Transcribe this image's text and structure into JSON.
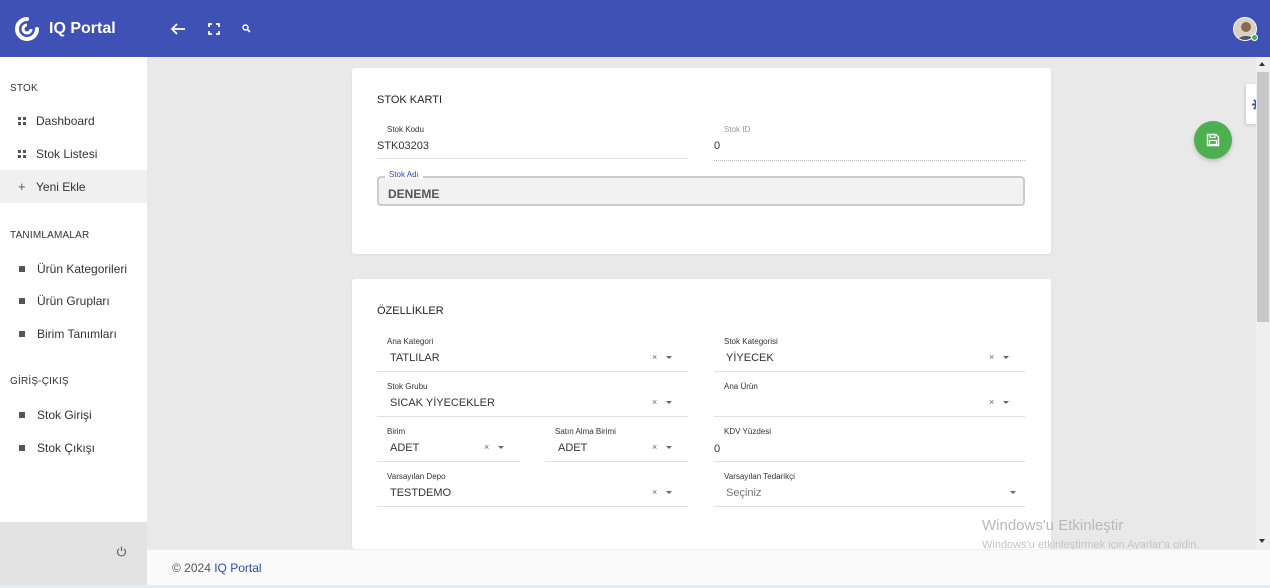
{
  "brand": {
    "name": "IQ Portal"
  },
  "sidebar": {
    "sections": [
      {
        "title": "STOK",
        "items": [
          {
            "label": "Dashboard",
            "icon": "grid-icon"
          },
          {
            "label": "Stok Listesi",
            "icon": "grid-icon"
          },
          {
            "label": "Yeni Ekle",
            "icon": "plus-icon",
            "active": true
          }
        ]
      },
      {
        "title": "TANIMLAMALAR",
        "items": [
          {
            "label": "Ürün Kategorileri",
            "icon": "square-icon"
          },
          {
            "label": "Ürün Grupları",
            "icon": "square-icon"
          },
          {
            "label": "Birim Tanımları",
            "icon": "square-icon"
          }
        ]
      },
      {
        "title": "GİRİŞ-ÇIKIŞ",
        "items": [
          {
            "label": "Stok Girişi",
            "icon": "square-icon"
          },
          {
            "label": "Stok Çıkışı",
            "icon": "square-icon"
          }
        ]
      }
    ]
  },
  "stok_karti": {
    "title": "STOK KARTI",
    "stok_kodu": {
      "label": "Stok Kodu",
      "value": "STK03203"
    },
    "stok_id": {
      "label": "Stok ID",
      "value": "0"
    },
    "stok_adi": {
      "label": "Stok Adı",
      "value": "DENEME"
    }
  },
  "ozellikler": {
    "title": "ÖZELLİKLER",
    "ana_kategori": {
      "label": "Ana Kategori",
      "value": "TATLILAR"
    },
    "stok_kategorisi": {
      "label": "Stok Kategorisi",
      "value": "YİYECEK"
    },
    "stok_grubu": {
      "label": "Stok Grubu",
      "value": "SICAK YİYECEKLER"
    },
    "ana_urun": {
      "label": "Ana Ürün",
      "value": ""
    },
    "birim": {
      "label": "Birim",
      "value": "ADET"
    },
    "satin_alma_birimi": {
      "label": "Satın Alma Birimi",
      "value": "ADET"
    },
    "kdv_yuzdesi": {
      "label": "KDV Yüzdesi",
      "value": "0"
    },
    "varsayilan_depo": {
      "label": "Varsayılan Depo",
      "value": "TESTDEMO"
    },
    "varsayilan_tedarikci": {
      "label": "Varsayılan Tedarikçi",
      "value": "Seçiniz"
    },
    "clear_glyph": "×"
  },
  "footer": {
    "prefix": "© 2024 ",
    "link": "IQ Portal"
  },
  "watermark": {
    "title": "Windows'u Etkinleştir",
    "subtitle": "Windows'u etkinleştirmek için Ayarlar'a gidin."
  },
  "colors": {
    "primary": "#3f51b5",
    "save": "#4caf50"
  }
}
